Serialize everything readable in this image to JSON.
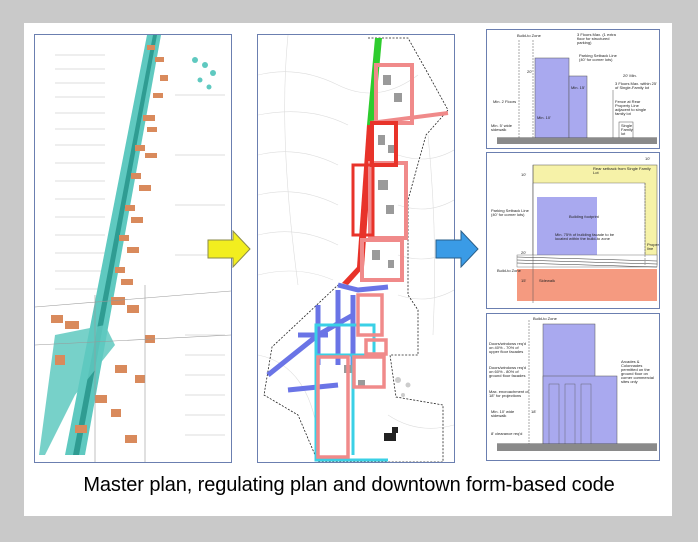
{
  "caption": "Master plan, regulating plan and downtown form-based code",
  "colors": {
    "background": "#c9c9c9",
    "card": "#ffffff",
    "arrow_yellow": "#f2ee1f",
    "arrow_blue": "#3a9be6",
    "green_zone": "#2ecc2e",
    "red_zone": "#e8332a",
    "pink_zone": "#f08a8a",
    "blue_zone": "#6a74e6",
    "cyan_zone": "#3ad0e6",
    "teal_corridor": "#5fc9c0",
    "building_purple": "#a9a9ef",
    "setback_yellow": "#f6f2a8",
    "sidewalk_orange": "#f59a80"
  },
  "diagram_top": {
    "build_to_zone": "Build-to Zone",
    "floors_max": "3 Floors Max. (1 extra floor for structured parking)",
    "parking_setback": "Parking Setback Line (40' for corner lots)",
    "min_2_floors": "Min. 2 Floors",
    "min_10": "Min. 10'",
    "min_5_sidewalk": "Min. 5' wide sidewalk",
    "min_15": "Min. 15'",
    "ft_20": "20'",
    "ft_20_min": "20' Min.",
    "floors_max_within": "3 Floors Max. within 25' of Single-Family lot",
    "fence": "Fence at Rear Property Line adjacent to single family lot",
    "single_family": "Single Family lot"
  },
  "diagram_mid": {
    "rear_setback": "Rear setback from Single Family Lot",
    "ft_10": "10'",
    "ft_10b": "10'",
    "parking_setback": "Parking Setback Line (40' for corner lots)",
    "building_footprint": "Building footprint",
    "min_75": "Min. 75% of building facade to be located within the build-to zone",
    "ft_20": "20'",
    "build_to_zone": "Build-to Zone",
    "ft_15": "15'",
    "sidewalk": "Sidewalk",
    "property_line": "Property line"
  },
  "diagram_bot": {
    "build_to_zone": "Build-to Zone",
    "doors_upper": "Doors/windows req'd on 40% - 70% of upper floor facades",
    "doors_ground": "Doors/windows req'd on 60% - 80% of ground floor facades",
    "max_encroachment": "Max. encroachment of 18\" for projections",
    "min_10_sidewalk": "Min. 10' wide sidewalk",
    "clearance": "8' clearance req'd",
    "ft_18": "18'",
    "arcades": "Arcades & Colonnades permitted on the ground floor on corner commercial sites only"
  }
}
